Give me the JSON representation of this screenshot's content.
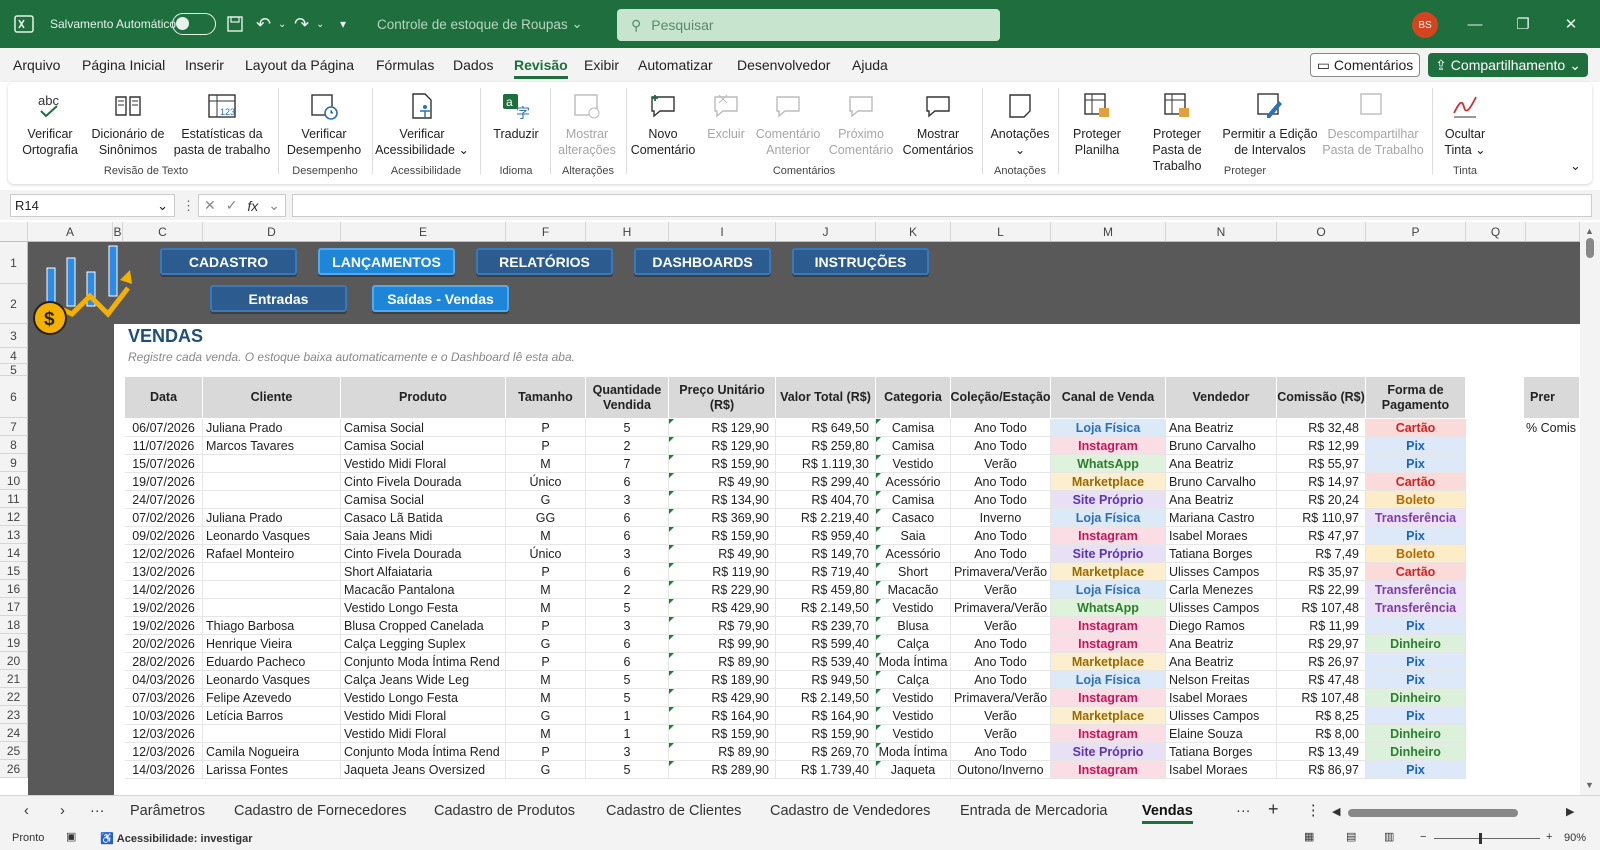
{
  "titlebar": {
    "autosave_label": "Salvamento Automático",
    "file_title": "Controle de estoque de Roupas",
    "search_placeholder": "Pesquisar",
    "avatar_initials": "BS"
  },
  "menu": [
    "Arquivo",
    "Página Inicial",
    "Inserir",
    "Layout da Página",
    "Fórmulas",
    "Dados",
    "Revisão",
    "Exibir",
    "Automatizar",
    "Desenvolvedor",
    "Ajuda"
  ],
  "menu_active": "Revisão",
  "comments_btn": "Comentários",
  "share_btn": "Compartilhamento",
  "ribbon": {
    "spelling": "Verificar Ortografia",
    "thesaurus": "Dicionário de Sinônimos",
    "stats": "Estatísticas da pasta de trabalho",
    "perf": "Verificar Desempenho",
    "access": "Verificar Acessibilidade",
    "translate": "Traduzir",
    "changes": "Mostrar alterações",
    "newc": "Novo Comentário",
    "del": "Excluir",
    "prevc": "Comentário Anterior",
    "nextc": "Próximo Comentário",
    "showc": "Mostrar Comentários",
    "notes": "Anotações",
    "protsheet": "Proteger Planilha",
    "protbook": "Proteger Pasta de Trabalho",
    "allow": "Permitir a Edição de Intervalos",
    "unshare": "Descompartilhar Pasta de Trabalho",
    "ink": "Ocultar Tinta",
    "groups": {
      "g1": "Revisão de Texto",
      "g2": "Desempenho",
      "g3": "Acessibilidade",
      "g4": "Idioma",
      "g5": "Alterações",
      "g6": "Comentários",
      "g7": "Anotações",
      "g8": "Proteger",
      "g9": "Tinta"
    }
  },
  "namebox": "R14",
  "columns": [
    "A",
    "B",
    "C",
    "D",
    "E",
    "F",
    "H",
    "I",
    "J",
    "K",
    "L",
    "M",
    "N",
    "O",
    "P",
    "Q"
  ],
  "rownums": [
    "1",
    "2",
    "3",
    "4",
    "5",
    "6",
    "7",
    "8",
    "9",
    "10",
    "11",
    "12",
    "13",
    "14",
    "15",
    "16",
    "17",
    "18",
    "19",
    "20",
    "21",
    "22",
    "23",
    "24",
    "25",
    "26"
  ],
  "nav": {
    "b1": "CADASTRO",
    "b2": "LANÇAMENTOS",
    "b3": "RELATÓRIOS",
    "b4": "DASHBOARDS",
    "b5": "INSTRUÇÕES",
    "s1": "Entradas",
    "s2": "Saídas - Vendas"
  },
  "sheet_title": "VENDAS",
  "sheet_subtitle": "Registre cada venda. O estoque baixa automaticamente e o Dashboard lê esta aba.",
  "headers": [
    "Data",
    "Cliente",
    "Produto",
    "Tamanho",
    "Quantidade Vendida",
    "Preço Unitário (R$)",
    "Valor Total (R$)",
    "Categoria",
    "Coleção/Estação",
    "Canal de Venda",
    "Vendedor",
    "Comissão (R$)",
    "Forma de Pagamento"
  ],
  "side_header": "Prer",
  "side_value": "% Comis",
  "channel_colors": {
    "Loja Física": [
      "#dce9f7",
      "#2e6fb5"
    ],
    "Instagram": [
      "#fbdde6",
      "#c2185b"
    ],
    "WhatsApp": [
      "#dff2dc",
      "#2e7d32"
    ],
    "Marketplace": [
      "#fcefcf",
      "#9a6a00"
    ],
    "Site Próprio": [
      "#e8e0f5",
      "#5e35b1"
    ]
  },
  "payment_colors": {
    "Cartão": [
      "#fbdada",
      "#c62828"
    ],
    "Pix": [
      "#dde9f8",
      "#1565c0"
    ],
    "Boleto": [
      "#fdecc8",
      "#b26a00"
    ],
    "Transferência": [
      "#ece2f7",
      "#7b3fa0"
    ],
    "Dinheiro": [
      "#dcf1dc",
      "#2e7d32"
    ]
  },
  "rows": [
    [
      "06/07/2026",
      "Juliana Prado",
      "Camisa Social",
      "P",
      "5",
      "R$ 129,90",
      "R$ 649,50",
      "Camisa",
      "Ano Todo",
      "Loja Física",
      "Ana Beatriz",
      "R$ 32,48",
      "Cartão"
    ],
    [
      "11/07/2026",
      "Marcos Tavares",
      "Camisa Social",
      "P",
      "2",
      "R$ 129,90",
      "R$ 259,80",
      "Camisa",
      "Ano Todo",
      "Instagram",
      "Bruno Carvalho",
      "R$ 12,99",
      "Pix"
    ],
    [
      "15/07/2026",
      "",
      "Vestido Midi Floral",
      "M",
      "7",
      "R$ 159,90",
      "R$ 1.119,30",
      "Vestido",
      "Verão",
      "WhatsApp",
      "Ana Beatriz",
      "R$ 55,97",
      "Pix"
    ],
    [
      "19/07/2026",
      "",
      "Cinto Fivela Dourada",
      "Único",
      "6",
      "R$ 49,90",
      "R$ 299,40",
      "Acessório",
      "Ano Todo",
      "Marketplace",
      "Bruno Carvalho",
      "R$ 14,97",
      "Cartão"
    ],
    [
      "24/07/2026",
      "",
      "Camisa Social",
      "G",
      "3",
      "R$ 134,90",
      "R$ 404,70",
      "Camisa",
      "Ano Todo",
      "Site Próprio",
      "Ana Beatriz",
      "R$ 20,24",
      "Boleto"
    ],
    [
      "07/02/2026",
      "Juliana Prado",
      "Casaco Lã Batida",
      "GG",
      "6",
      "R$ 369,90",
      "R$ 2.219,40",
      "Casaco",
      "Inverno",
      "Loja Física",
      "Mariana Castro",
      "R$ 110,97",
      "Transferência"
    ],
    [
      "09/02/2026",
      "Leonardo Vasques",
      "Saia Jeans Midi",
      "M",
      "6",
      "R$ 159,90",
      "R$ 959,40",
      "Saia",
      "Ano Todo",
      "Instagram",
      "Isabel Moraes",
      "R$ 47,97",
      "Pix"
    ],
    [
      "12/02/2026",
      "Rafael Monteiro",
      "Cinto Fivela Dourada",
      "Único",
      "3",
      "R$ 49,90",
      "R$ 149,70",
      "Acessório",
      "Ano Todo",
      "Site Próprio",
      "Tatiana Borges",
      "R$ 7,49",
      "Boleto"
    ],
    [
      "13/02/2026",
      "",
      "Short Alfaiataria",
      "P",
      "6",
      "R$ 119,90",
      "R$ 719,40",
      "Short",
      "Primavera/Verão",
      "Marketplace",
      "Ulisses Campos",
      "R$ 35,97",
      "Cartão"
    ],
    [
      "14/02/2026",
      "",
      "Macacão Pantalona",
      "M",
      "2",
      "R$ 229,90",
      "R$ 459,80",
      "Macacão",
      "Verão",
      "Loja Física",
      "Carla Menezes",
      "R$ 22,99",
      "Transferência"
    ],
    [
      "19/02/2026",
      "",
      "Vestido Longo Festa",
      "M",
      "5",
      "R$ 429,90",
      "R$ 2.149,50",
      "Vestido",
      "Primavera/Verão",
      "WhatsApp",
      "Ulisses Campos",
      "R$ 107,48",
      "Transferência"
    ],
    [
      "19/02/2026",
      "Thiago Barbosa",
      "Blusa Cropped Canelada",
      "P",
      "3",
      "R$ 79,90",
      "R$ 239,70",
      "Blusa",
      "Verão",
      "Instagram",
      "Diego Ramos",
      "R$ 11,99",
      "Pix"
    ],
    [
      "20/02/2026",
      "Henrique Vieira",
      "Calça Legging Suplex",
      "G",
      "6",
      "R$ 99,90",
      "R$ 599,40",
      "Calça",
      "Ano Todo",
      "Instagram",
      "Ana Beatriz",
      "R$ 29,97",
      "Dinheiro"
    ],
    [
      "28/02/2026",
      "Eduardo Pacheco",
      "Conjunto Moda Íntima Rend",
      "P",
      "6",
      "R$ 89,90",
      "R$ 539,40",
      "Moda Íntima",
      "Ano Todo",
      "Marketplace",
      "Ana Beatriz",
      "R$ 26,97",
      "Pix"
    ],
    [
      "04/03/2026",
      "Leonardo Vasques",
      "Calça Jeans Wide Leg",
      "M",
      "5",
      "R$ 189,90",
      "R$ 949,50",
      "Calça",
      "Ano Todo",
      "Loja Física",
      "Nelson Freitas",
      "R$ 47,48",
      "Pix"
    ],
    [
      "07/03/2026",
      "Felipe Azevedo",
      "Vestido Longo Festa",
      "M",
      "5",
      "R$ 429,90",
      "R$ 2.149,50",
      "Vestido",
      "Primavera/Verão",
      "Instagram",
      "Isabel Moraes",
      "R$ 107,48",
      "Dinheiro"
    ],
    [
      "10/03/2026",
      "Letícia Barros",
      "Vestido Midi Floral",
      "G",
      "1",
      "R$ 164,90",
      "R$ 164,90",
      "Vestido",
      "Verão",
      "Marketplace",
      "Ulisses Campos",
      "R$ 8,25",
      "Pix"
    ],
    [
      "12/03/2026",
      "",
      "Vestido Midi Floral",
      "M",
      "1",
      "R$ 159,90",
      "R$ 159,90",
      "Vestido",
      "Verão",
      "Instagram",
      "Elaine Souza",
      "R$ 8,00",
      "Dinheiro"
    ],
    [
      "12/03/2026",
      "Camila Nogueira",
      "Conjunto Moda Íntima Rend",
      "P",
      "3",
      "R$ 89,90",
      "R$ 269,70",
      "Moda Íntima",
      "Ano Todo",
      "Site Próprio",
      "Tatiana Borges",
      "R$ 13,49",
      "Dinheiro"
    ],
    [
      "14/03/2026",
      "Larissa Fontes",
      "Jaqueta Jeans Oversized",
      "G",
      "5",
      "R$ 289,90",
      "R$ 1.739,40",
      "Jaqueta",
      "Outono/Inverno",
      "Instagram",
      "Isabel Moraes",
      "R$ 86,97",
      "Pix"
    ]
  ],
  "tabs": [
    "Parâmetros",
    "Cadastro de Fornecedores",
    "Cadastro de Produtos",
    "Cadastro de Clientes",
    "Cadastro de Vendedores",
    "Entrada de Mercadoria",
    "Vendas"
  ],
  "tab_active": "Vendas",
  "status": {
    "ready": "Pronto",
    "access": "Acessibilidade: investigar",
    "zoom": "90%"
  }
}
